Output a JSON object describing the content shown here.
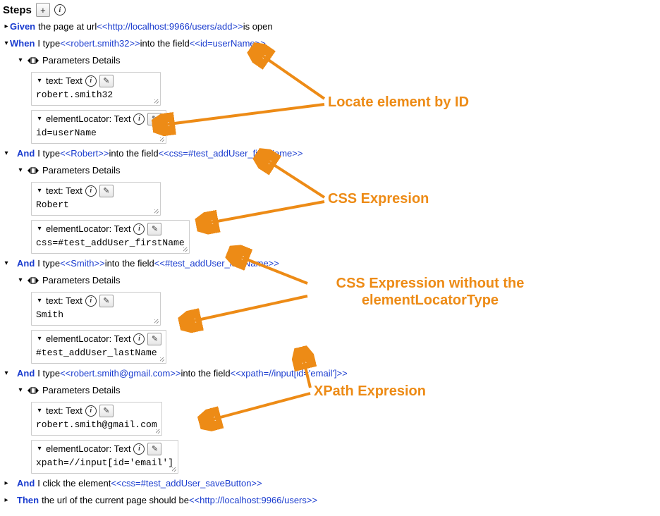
{
  "header": {
    "title": "Steps",
    "add": "+"
  },
  "steps": {
    "given": {
      "kw": "Given",
      "pre": "the page at url ",
      "url": "<<http://localhost:9966/users/add>>",
      "post": " is open"
    },
    "when": {
      "kw": "When",
      "pre": "I type ",
      "val": "<<robert.smith32>>",
      "mid": " into the field ",
      "loc": "<<id=userName>>",
      "pd": "Parameters Details",
      "p1": {
        "lab": "text: Text",
        "val": "robert.smith32"
      },
      "p2": {
        "lab": "elementLocator: Text",
        "val": "id=userName"
      }
    },
    "and1": {
      "kw": "And",
      "pre": "I type ",
      "val": "<<Robert>>",
      "mid": " into the field ",
      "loc": "<<css=#test_addUser_firstName>>",
      "pd": "Parameters Details",
      "p1": {
        "lab": "text: Text",
        "val": "Robert"
      },
      "p2": {
        "lab": "elementLocator: Text",
        "val": "css=#test_addUser_firstName"
      }
    },
    "and2": {
      "kw": "And",
      "pre": "I type ",
      "val": "<<Smith>>",
      "mid": " into the field ",
      "loc": "<<#test_addUser_lastName>>",
      "pd": "Parameters Details",
      "p1": {
        "lab": "text: Text",
        "val": "Smith"
      },
      "p2": {
        "lab": "elementLocator: Text",
        "val": "#test_addUser_lastName"
      }
    },
    "and3": {
      "kw": "And",
      "pre": "I type ",
      "val": "<<robert.smith@gmail.com>>",
      "mid": " into the field ",
      "loc": "<<xpath=//input[id='email']>>",
      "pd": "Parameters Details",
      "p1": {
        "lab": "text: Text",
        "val": "robert.smith@gmail.com"
      },
      "p2": {
        "lab": "elementLocator: Text",
        "val": "xpath=//input[id='email']"
      }
    },
    "and4": {
      "kw": "And",
      "pre": "I click the element ",
      "loc": "<<css=#test_addUser_saveButton>>"
    },
    "then": {
      "kw": "Then",
      "pre": "the url of the current page should be ",
      "loc": "<<http://localhost:9966/users>>"
    }
  },
  "ann": {
    "a1": "Locate element by ID",
    "a2": "CSS Expresion",
    "a3": "CSS Expression without the elementLocatorType",
    "a4": "XPath Expresion"
  }
}
